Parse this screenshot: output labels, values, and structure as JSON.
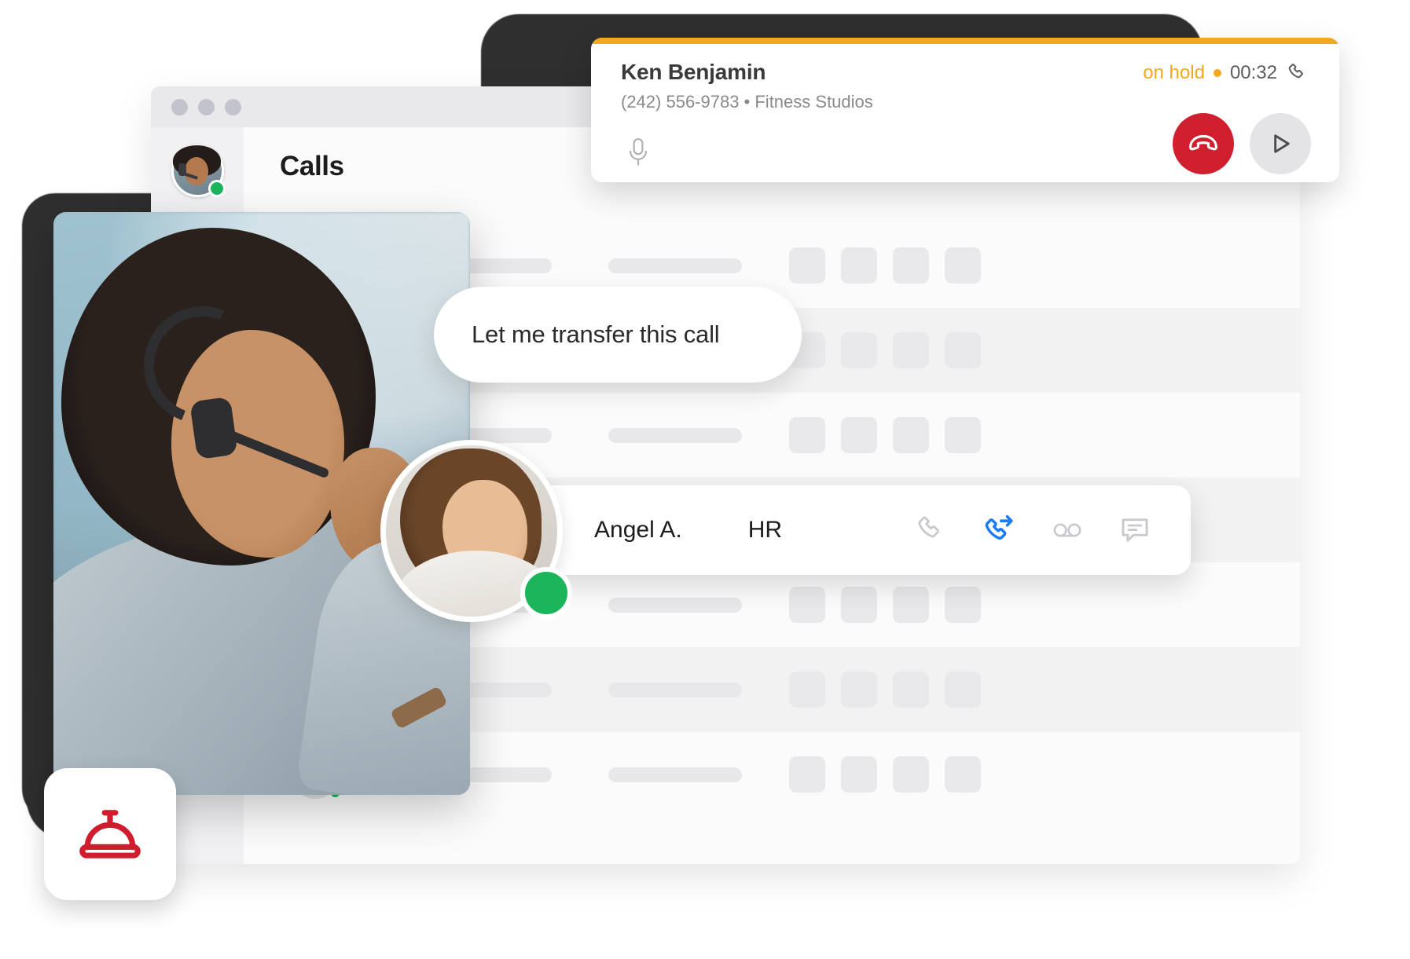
{
  "window": {
    "traffic_lights": [
      "close",
      "minimize",
      "maximize"
    ],
    "page_title": "Calls",
    "sidebar": {
      "avatar_name": "agent-avatar",
      "presence": "online",
      "presence_color": "#1cb55c",
      "nav_placeholders": 1
    }
  },
  "call_card": {
    "accent_color": "#f2a81f",
    "caller_name": "Ken Benjamin",
    "caller_meta": "(242) 556-9783 • Fitness Studios",
    "phone_number": "(242) 556-9783",
    "company": "Fitness Studios",
    "status_text": "on hold",
    "status_color": "#f2a81f",
    "timer": "00:32",
    "phone_icon": "phone-icon",
    "mic_icon": "microphone-icon",
    "hangup_label": "hang-up",
    "hangup_color": "#d0202f",
    "resume_label": "resume",
    "resume_color": "#e4e4e6"
  },
  "speech_bubble": {
    "text": "Let me transfer this call"
  },
  "contact_row": {
    "name": "Angel A.",
    "department": "HR",
    "actions": [
      {
        "name": "call-icon",
        "color": "#c9c9cd",
        "active": false
      },
      {
        "name": "transfer-call-icon",
        "color": "#1a7cf5",
        "active": true
      },
      {
        "name": "voicemail-icon",
        "color": "#c9c9cd",
        "active": false
      },
      {
        "name": "message-icon",
        "color": "#c9c9cd",
        "active": false
      }
    ]
  },
  "second_agent": {
    "presence": "online",
    "presence_color": "#1cb55c"
  },
  "bell_tile": {
    "icon": "service-bell-icon",
    "color": "#cf1d2d"
  },
  "skeleton_rows": [
    {
      "status": "green",
      "shaded": false
    },
    {
      "status": "grey",
      "shaded": true
    },
    {
      "status": "green",
      "shaded": false
    },
    {
      "status": "grey",
      "shaded": true
    },
    {
      "status": "grey",
      "shaded": false
    },
    {
      "status": "red",
      "shaded": true
    },
    {
      "status": "green",
      "shaded": false
    }
  ]
}
